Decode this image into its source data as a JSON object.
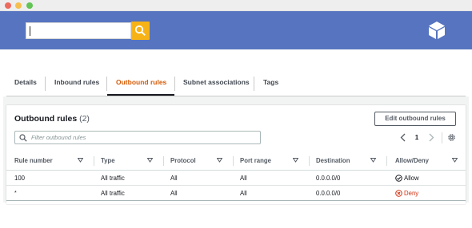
{
  "window": {
    "title": ""
  },
  "search": {
    "value": "",
    "placeholder": ""
  },
  "tabs": [
    {
      "label": "Details",
      "active": false
    },
    {
      "label": "Inbound rules",
      "active": false
    },
    {
      "label": "Outbound rules",
      "active": true
    },
    {
      "label": "Subnet associations",
      "active": false
    },
    {
      "label": "Tags",
      "active": false
    }
  ],
  "panel": {
    "title": "Outbound rules",
    "count": "(2)",
    "edit_button": "Edit outbound rules",
    "filter_placeholder": "Filter outbound rules",
    "page": "1"
  },
  "table": {
    "columns": [
      "Rule number",
      "Type",
      "Protocol",
      "Port range",
      "Destination",
      "Allow/Deny"
    ],
    "rows": [
      {
        "rule": "100",
        "type": "All traffic",
        "protocol": "All",
        "port": "All",
        "destination": "0.0.0.0/0",
        "action": "Allow"
      },
      {
        "rule": "*",
        "type": "All traffic",
        "protocol": "All",
        "port": "All",
        "destination": "0.0.0.0/0",
        "action": "Deny"
      }
    ]
  },
  "colors": {
    "header": "#5674bf",
    "search_button": "#f7b315",
    "active_tab": "#d45b07",
    "allow": "#1d8102",
    "deny": "#d13212"
  },
  "icons": [
    "search-icon",
    "cube-logo-icon",
    "filter-search-icon",
    "chevron-left-icon",
    "chevron-right-icon",
    "gear-icon",
    "sort-caret-icon",
    "check-circle-icon",
    "x-circle-icon"
  ]
}
